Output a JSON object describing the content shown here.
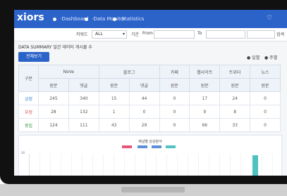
{
  "app": {
    "logo": "xiors",
    "nav": [
      "·Dashboard",
      "·Data Monitor",
      "·Statistics"
    ],
    "top_right_icon": "heart-icon"
  },
  "filters": {
    "keyword_label": "키워드",
    "category_value": "ALL",
    "period_label": "기간",
    "from_label": "From",
    "to_label": "To",
    "search_button": "검색"
  },
  "summary": {
    "title": "DATA SUMMARY 일간 데이터 게시물 수",
    "view_all_button": "전체보기",
    "toggle_daily": "일별",
    "toggle_monthly": "주별",
    "table": {
      "corner_header": "구분",
      "groups": [
        "NeVe",
        "블로그",
        "카페",
        "웹사이트",
        "트위터",
        "뉴스"
      ],
      "subheaders": [
        "원문",
        "댓글",
        "원문",
        "댓글",
        "원문",
        "원문",
        "원문",
        "원문"
      ],
      "rows": [
        {
          "label": "긍정",
          "color": "#2f7fd1",
          "values": [
            "245",
            "340",
            "15",
            "44",
            "0",
            "17",
            "24",
            "0"
          ]
        },
        {
          "label": "부정",
          "color": "#d9534f",
          "values": [
            "28",
            "132",
            "1",
            "0",
            "0",
            "9",
            "8",
            "0"
          ]
        },
        {
          "label": "중립",
          "color": "#3c9c46",
          "values": [
            "124",
            "111",
            "43",
            "29",
            "0",
            "66",
            "33",
            "0"
          ]
        }
      ]
    }
  },
  "chart": {
    "title": "채널별 감성분석",
    "legend": [
      {
        "label": "",
        "color": "#e8557a"
      },
      {
        "label": "",
        "color": "#5b8fd8"
      },
      {
        "label": "",
        "color": "#4fc1c1"
      }
    ],
    "y_tick": "30"
  },
  "colors": {
    "nav_bar": "#2c63c9",
    "header_fill": "#eef3fa",
    "bezel": "#1a1a1a",
    "base": "#c7c7c7"
  }
}
